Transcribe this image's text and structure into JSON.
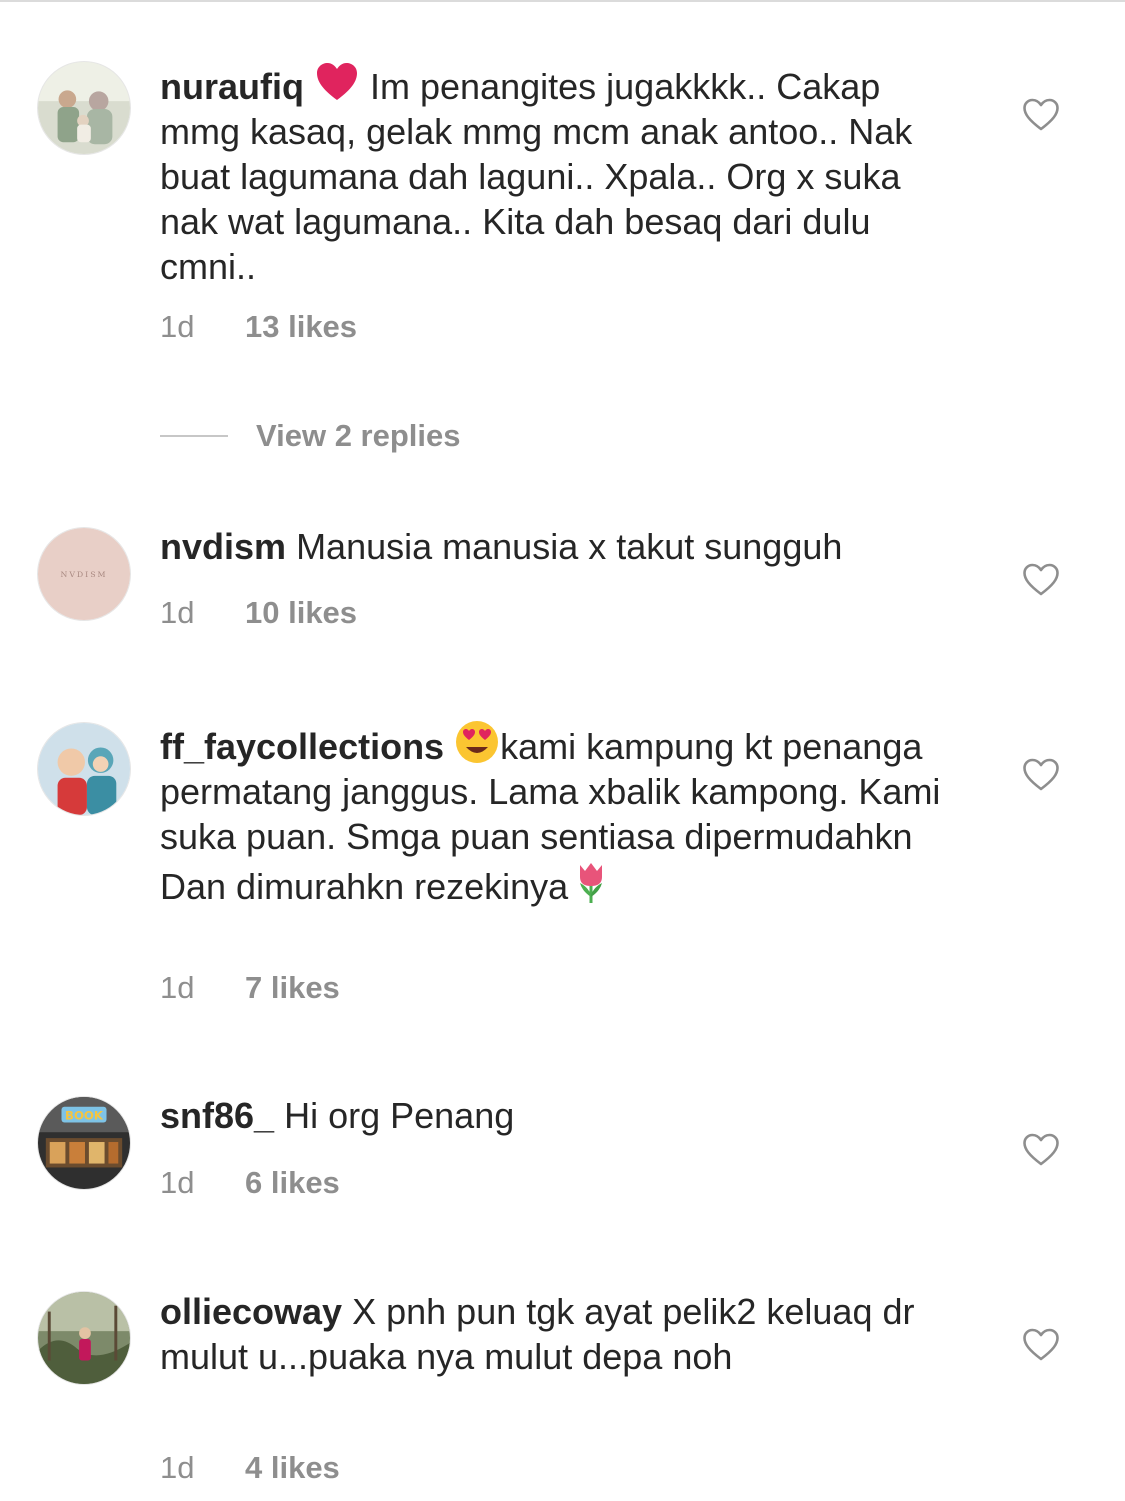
{
  "comments": [
    {
      "username": "nuraufiq",
      "emoji": "red-heart",
      "text": "Im penangites jugakkkk.. Cakap mmg kasaq, gelak mmg mcm anak antoo.. Nak buat lagumana dah laguni.. Xpala.. Org x suka nak wat lagumana.. Kita dah besaq dari dulu cmni..",
      "time": "1d",
      "likes": "13 likes",
      "replies_label": "View 2 replies"
    },
    {
      "username": "nvdism",
      "avatar_text": "NVDISM",
      "text": "Manusia manusia x takut sungguh",
      "time": "1d",
      "likes": "10 likes"
    },
    {
      "username": "ff_faycollections",
      "emoji": "heart-eyes",
      "text": "kami kampung kt penanga permatang janggus. Lama xbalik kampong. Kami suka puan. Smga puan sentiasa dipermudahkn Dan dimurahkn rezekinya",
      "trailing_emoji": "tulip",
      "time": "1d",
      "likes": "7 likes"
    },
    {
      "username": "snf86_",
      "avatar_text": "BOOK",
      "text": "Hi org Penang",
      "time": "1d",
      "likes": "6 likes"
    },
    {
      "username": "olliecoway",
      "text": "X pnh pun tgk ayat pelik2 keluaq dr mulut u...puaka nya mulut depa noh",
      "time": "1d",
      "likes": "4 likes"
    }
  ],
  "colors": {
    "text": "#262626",
    "muted": "#8e8e8e",
    "heart_emoji": "#e0245e"
  }
}
